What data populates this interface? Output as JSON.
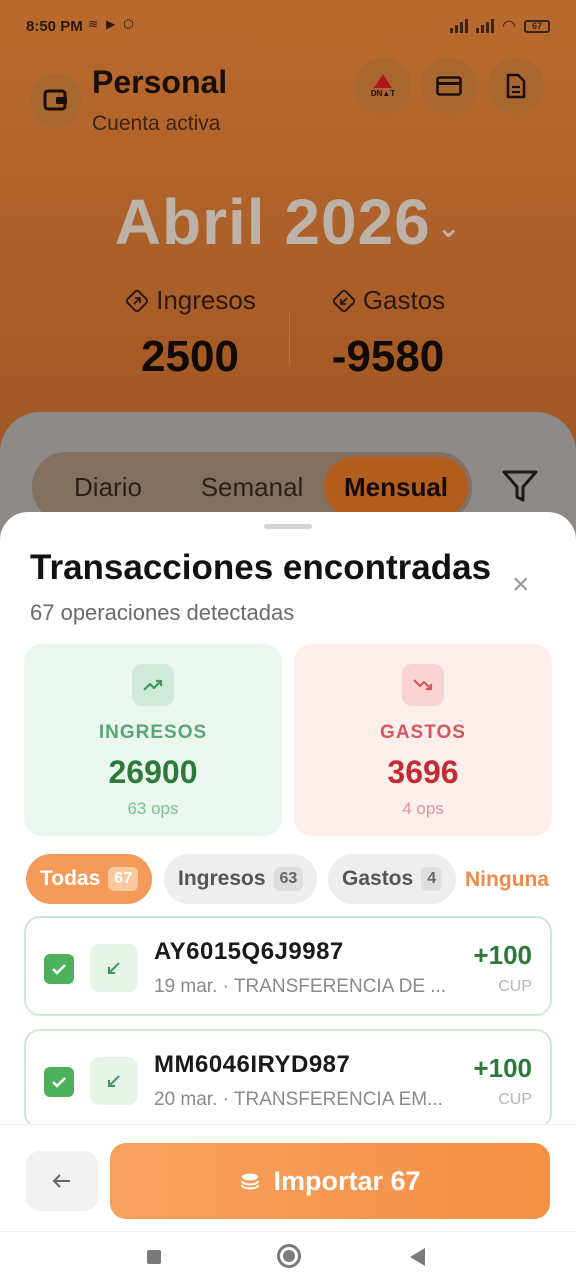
{
  "status": {
    "time": "8:50 PM",
    "battery": "67"
  },
  "header": {
    "account_name": "Personal",
    "account_status": "Cuenta activa",
    "dnat_label": "DN▲T"
  },
  "period": {
    "month": "Abril 2026"
  },
  "summary": {
    "income_label": "Ingresos",
    "income_value": "2500",
    "expense_label": "Gastos",
    "expense_value": "-9580"
  },
  "tabs": [
    {
      "label": "Diario"
    },
    {
      "label": "Semanal"
    },
    {
      "label": "Mensual"
    }
  ],
  "sheet": {
    "title": "Transacciones encontradas",
    "subtitle": "67 operaciones detectadas",
    "close": "×",
    "income_card": {
      "label": "INGRESOS",
      "value": "26900",
      "ops": "63 ops"
    },
    "expense_card": {
      "label": "GASTOS",
      "value": "3696",
      "ops": "4 ops"
    },
    "chips": {
      "all_label": "Todas",
      "all_count": "67",
      "income_label": "Ingresos",
      "income_count": "63",
      "expense_label": "Gastos",
      "expense_count": "4",
      "none_label": "Ninguna"
    },
    "transactions": [
      {
        "ref": "AY6015Q6J9987",
        "desc": "19 mar. · TRANSFERENCIA DE ...",
        "amount": "+100",
        "currency": "CUP"
      },
      {
        "ref": "MM6046IRYD987",
        "desc": "20 mar. · TRANSFERENCIA EM...",
        "amount": "+100",
        "currency": "CUP"
      }
    ],
    "import_label": "Importar 67"
  },
  "colors": {
    "accent": "#f58f44",
    "income": "#2b7a3a",
    "expense": "#c32b31"
  }
}
